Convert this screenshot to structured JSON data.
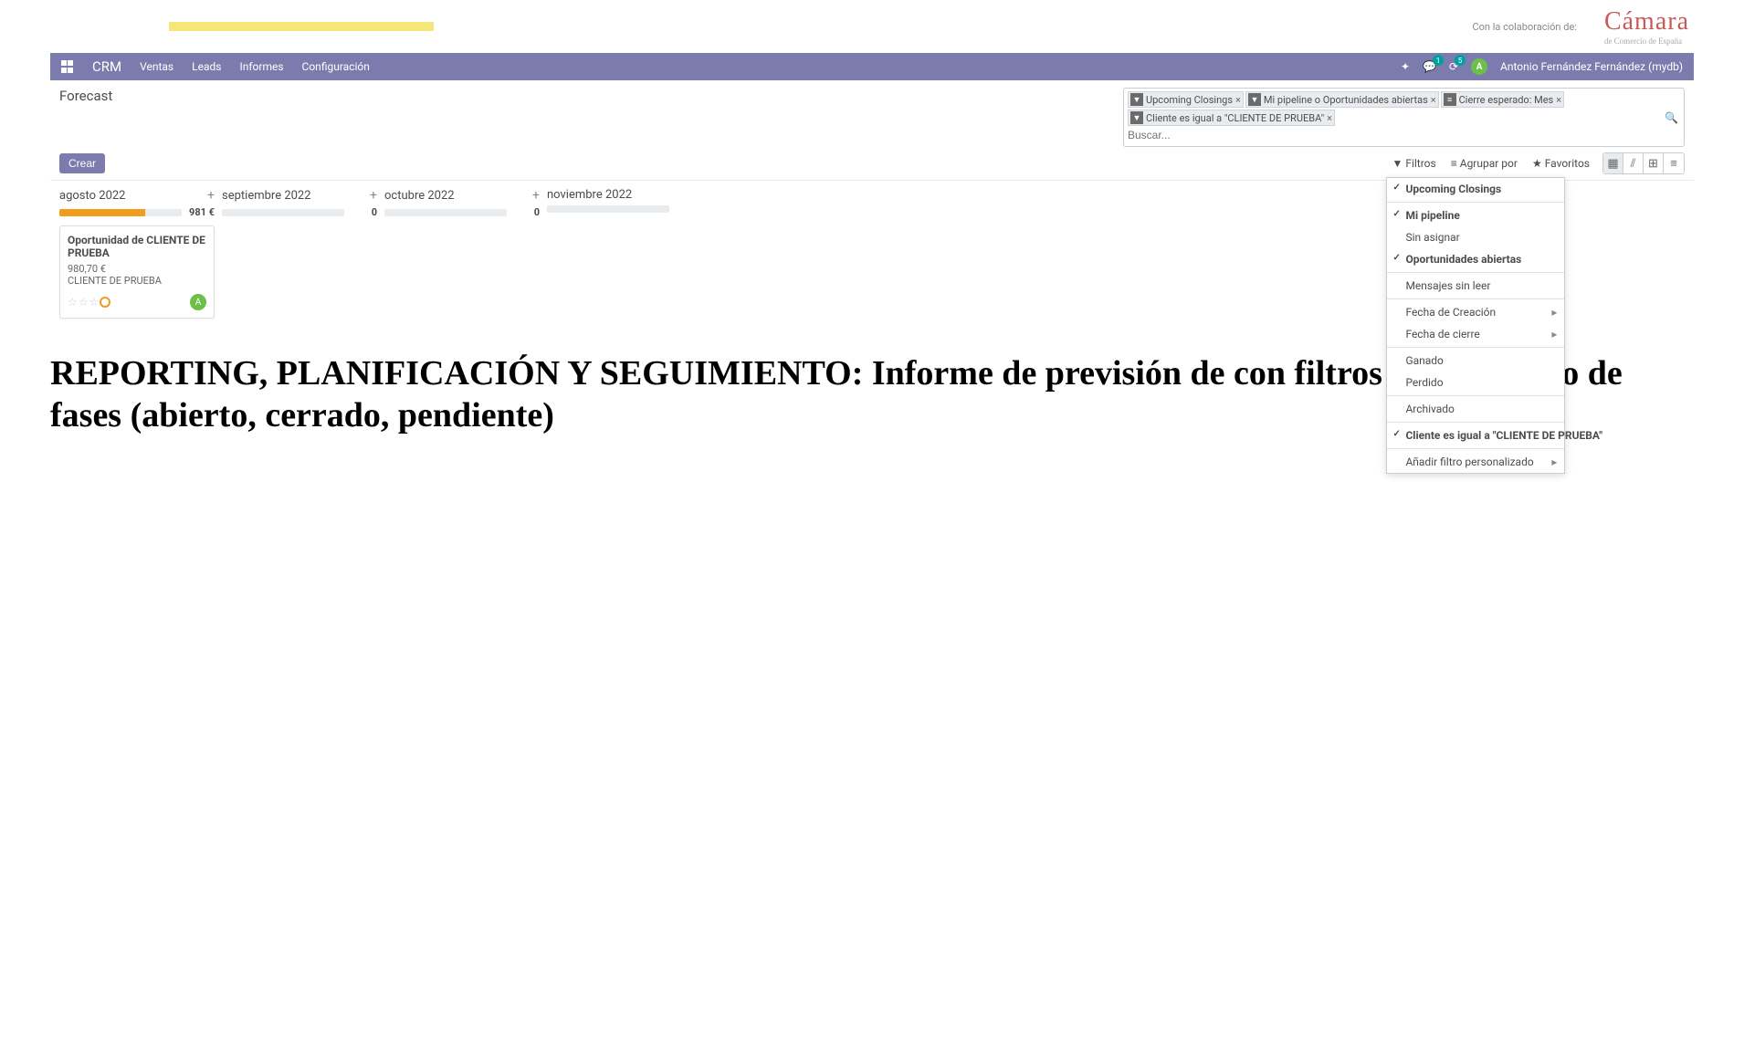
{
  "header": {
    "collab_text": "Con la colaboración de:",
    "camara_main": "Cámara",
    "camara_sub": "de Comercio de España"
  },
  "nav": {
    "brand": "CRM",
    "items": [
      "Ventas",
      "Leads",
      "Informes",
      "Configuración"
    ],
    "msg_count": "1",
    "activity_count": "5",
    "user_initial": "A",
    "user_name": "Antonio Fernández Fernández (mydb)"
  },
  "control": {
    "title": "Forecast",
    "create": "Crear",
    "search_placeholder": "Buscar...",
    "chips": [
      {
        "label": "Upcoming Closings",
        "icon": "▼"
      },
      {
        "label": "Mi pipeline o Oportunidades abiertas",
        "icon": "▼"
      },
      {
        "label": "Cierre esperado: Mes",
        "icon": "≡"
      },
      {
        "label": "Cliente es igual a \"CLIENTE DE PRUEBA\"",
        "icon": "▼"
      }
    ],
    "toolbar": {
      "filters": "Filtros",
      "group_by": "Agrupar por",
      "favorites": "Favoritos"
    }
  },
  "filter_menu": {
    "g1": [
      {
        "label": "Upcoming Closings",
        "checked": true
      }
    ],
    "g2": [
      {
        "label": "Mi pipeline",
        "checked": true
      },
      {
        "label": "Sin asignar",
        "checked": false
      },
      {
        "label": "Oportunidades abiertas",
        "checked": true
      }
    ],
    "g3": [
      {
        "label": "Mensajes sin leer",
        "checked": false
      }
    ],
    "g4": [
      {
        "label": "Fecha de Creación",
        "checked": false,
        "sub": true
      },
      {
        "label": "Fecha de cierre",
        "checked": false,
        "sub": true
      }
    ],
    "g5": [
      {
        "label": "Ganado",
        "checked": false
      },
      {
        "label": "Perdido",
        "checked": false
      }
    ],
    "g6": [
      {
        "label": "Archivado",
        "checked": false
      }
    ],
    "g7": [
      {
        "label": "Cliente es igual a \"CLIENTE DE PRUEBA\"",
        "checked": true
      }
    ],
    "g8": [
      {
        "label": "Añadir filtro personalizado",
        "checked": false,
        "sub": true
      }
    ]
  },
  "kanban": {
    "columns": [
      {
        "title": "agosto 2022",
        "total": "981 €",
        "fill": 70
      },
      {
        "title": "septiembre 2022",
        "total": "0",
        "fill": 0
      },
      {
        "title": "octubre 2022",
        "total": "0",
        "fill": 0
      },
      {
        "title": "noviembre 2022",
        "total": "",
        "fill": 0
      }
    ],
    "card": {
      "title": "Oportunidad de CLIENTE DE PRUEBA",
      "amount": "980,70 €",
      "client": "CLIENTE DE PRUEBA",
      "avatar": "A"
    }
  },
  "bottom_heading": "REPORTING, PLANIFICACIÓN Y SEGUIMIENTO: Informe de previsión de con filtros según estado de fases (abierto, cerrado, pendiente)"
}
